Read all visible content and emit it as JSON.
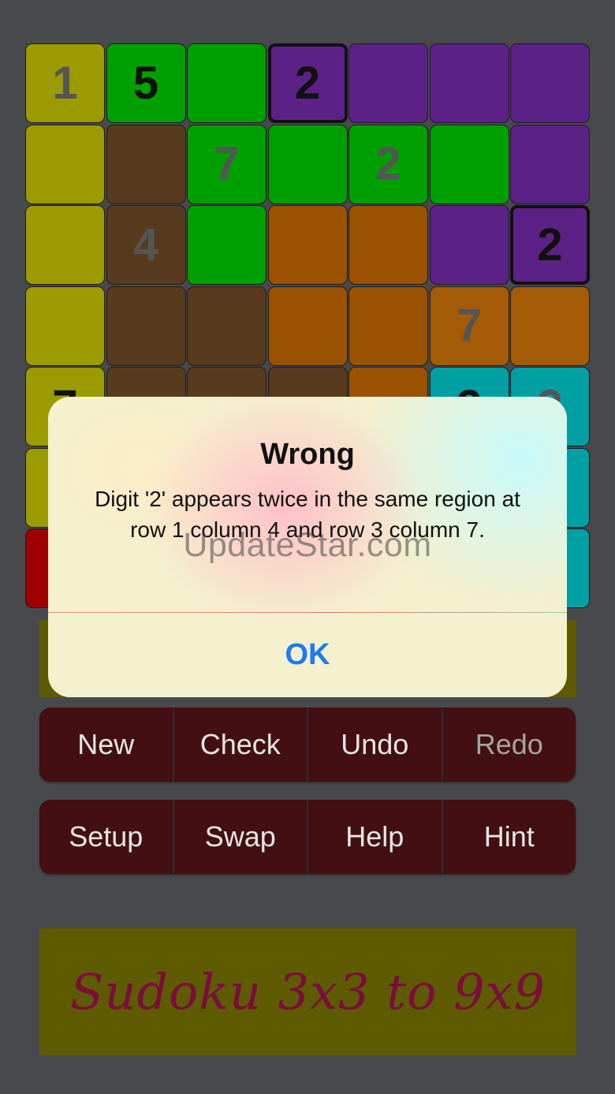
{
  "colors": {
    "background": "#48494d",
    "olive": "#9b9a00",
    "green": "#009f00",
    "purple": "#5b2187",
    "brown": "#583a1e",
    "orange": "#9a5100",
    "orange_light": "#a55a05",
    "teal": "#009fa3",
    "red": "#9e0000",
    "button": "#430f12",
    "banner": "#5e5a00",
    "alert_ok": "#1a7cf0"
  },
  "grid": {
    "cells": [
      {
        "row": 1,
        "col": 1,
        "color": "olive",
        "digit": "1",
        "style": "hint"
      },
      {
        "row": 1,
        "col": 2,
        "color": "green",
        "digit": "5",
        "style": "given"
      },
      {
        "row": 1,
        "col": 3,
        "color": "green",
        "digit": "",
        "style": "given"
      },
      {
        "row": 1,
        "col": 4,
        "color": "purple",
        "digit": "2",
        "style": "given",
        "selected": true
      },
      {
        "row": 1,
        "col": 5,
        "color": "purple",
        "digit": "",
        "style": "given"
      },
      {
        "row": 1,
        "col": 6,
        "color": "purple",
        "digit": "",
        "style": "given"
      },
      {
        "row": 1,
        "col": 7,
        "color": "purple",
        "digit": "",
        "style": "given"
      },
      {
        "row": 2,
        "col": 1,
        "color": "olive",
        "digit": "",
        "style": "given"
      },
      {
        "row": 2,
        "col": 2,
        "color": "brown",
        "digit": "",
        "style": "given"
      },
      {
        "row": 2,
        "col": 3,
        "color": "green",
        "digit": "7",
        "style": "hint"
      },
      {
        "row": 2,
        "col": 4,
        "color": "green",
        "digit": "",
        "style": "given"
      },
      {
        "row": 2,
        "col": 5,
        "color": "green",
        "digit": "2",
        "style": "hint"
      },
      {
        "row": 2,
        "col": 6,
        "color": "green",
        "digit": "",
        "style": "given"
      },
      {
        "row": 2,
        "col": 7,
        "color": "purple",
        "digit": "",
        "style": "given"
      },
      {
        "row": 3,
        "col": 1,
        "color": "olive",
        "digit": "",
        "style": "given"
      },
      {
        "row": 3,
        "col": 2,
        "color": "brown",
        "digit": "4",
        "style": "hint"
      },
      {
        "row": 3,
        "col": 3,
        "color": "green",
        "digit": "",
        "style": "given"
      },
      {
        "row": 3,
        "col": 4,
        "color": "orange",
        "digit": "",
        "style": "given"
      },
      {
        "row": 3,
        "col": 5,
        "color": "orange",
        "digit": "",
        "style": "given"
      },
      {
        "row": 3,
        "col": 6,
        "color": "purple",
        "digit": "",
        "style": "given"
      },
      {
        "row": 3,
        "col": 7,
        "color": "purple",
        "digit": "2",
        "style": "given",
        "selected": true
      },
      {
        "row": 4,
        "col": 1,
        "color": "olive",
        "digit": "",
        "style": "given"
      },
      {
        "row": 4,
        "col": 2,
        "color": "brown",
        "digit": "",
        "style": "given"
      },
      {
        "row": 4,
        "col": 3,
        "color": "brown",
        "digit": "",
        "style": "given"
      },
      {
        "row": 4,
        "col": 4,
        "color": "orange",
        "digit": "",
        "style": "given"
      },
      {
        "row": 4,
        "col": 5,
        "color": "orange",
        "digit": "",
        "style": "given"
      },
      {
        "row": 4,
        "col": 6,
        "color": "orange_light",
        "digit": "7",
        "style": "hint"
      },
      {
        "row": 4,
        "col": 7,
        "color": "orange_light",
        "digit": "",
        "style": "given"
      },
      {
        "row": 5,
        "col": 1,
        "color": "olive",
        "digit": "7",
        "style": "given"
      },
      {
        "row": 5,
        "col": 2,
        "color": "brown",
        "digit": "",
        "style": "given"
      },
      {
        "row": 5,
        "col": 3,
        "color": "brown",
        "digit": "",
        "style": "given"
      },
      {
        "row": 5,
        "col": 4,
        "color": "brown",
        "digit": "",
        "style": "given"
      },
      {
        "row": 5,
        "col": 5,
        "color": "orange",
        "digit": "",
        "style": "given"
      },
      {
        "row": 5,
        "col": 6,
        "color": "teal",
        "digit": "2",
        "style": "given"
      },
      {
        "row": 5,
        "col": 7,
        "color": "teal",
        "digit": "3",
        "style": "hint"
      },
      {
        "row": 6,
        "col": 1,
        "color": "olive",
        "digit": "",
        "style": "given"
      },
      {
        "row": 6,
        "col": 2,
        "color": "brown",
        "digit": "",
        "style": "given"
      },
      {
        "row": 6,
        "col": 3,
        "color": "brown",
        "digit": "",
        "style": "given"
      },
      {
        "row": 6,
        "col": 4,
        "color": "brown",
        "digit": "",
        "style": "given"
      },
      {
        "row": 6,
        "col": 5,
        "color": "orange",
        "digit": "",
        "style": "given"
      },
      {
        "row": 6,
        "col": 6,
        "color": "teal",
        "digit": "",
        "style": "given"
      },
      {
        "row": 6,
        "col": 7,
        "color": "teal",
        "digit": "",
        "style": "given"
      },
      {
        "row": 7,
        "col": 1,
        "color": "red",
        "digit": "",
        "style": "given"
      },
      {
        "row": 7,
        "col": 2,
        "color": "red",
        "digit": "",
        "style": "given"
      },
      {
        "row": 7,
        "col": 3,
        "color": "red",
        "digit": "",
        "style": "given"
      },
      {
        "row": 7,
        "col": 4,
        "color": "teal",
        "digit": "",
        "style": "given"
      },
      {
        "row": 7,
        "col": 5,
        "color": "teal",
        "digit": "",
        "style": "given"
      },
      {
        "row": 7,
        "col": 6,
        "color": "teal",
        "digit": "",
        "style": "given"
      },
      {
        "row": 7,
        "col": 7,
        "color": "teal",
        "digit": "",
        "style": "given"
      }
    ]
  },
  "controls": {
    "row1": [
      {
        "key": "new",
        "label": "New",
        "enabled": true
      },
      {
        "key": "check",
        "label": "Check",
        "enabled": true
      },
      {
        "key": "undo",
        "label": "Undo",
        "enabled": true
      },
      {
        "key": "redo",
        "label": "Redo",
        "enabled": false
      }
    ],
    "row2": [
      {
        "key": "setup",
        "label": "Setup",
        "enabled": true
      },
      {
        "key": "swap",
        "label": "Swap",
        "enabled": true
      },
      {
        "key": "help",
        "label": "Help",
        "enabled": true
      },
      {
        "key": "hint",
        "label": "Hint",
        "enabled": true
      }
    ]
  },
  "banner": {
    "text": "Sudoku 3x3 to 9x9"
  },
  "alert": {
    "title": "Wrong",
    "message": "Digit '2' appears twice in the same region at row 1 column 4 and row 3 column 7.",
    "ok_label": "OK"
  },
  "watermark": "UpdateStar.com"
}
